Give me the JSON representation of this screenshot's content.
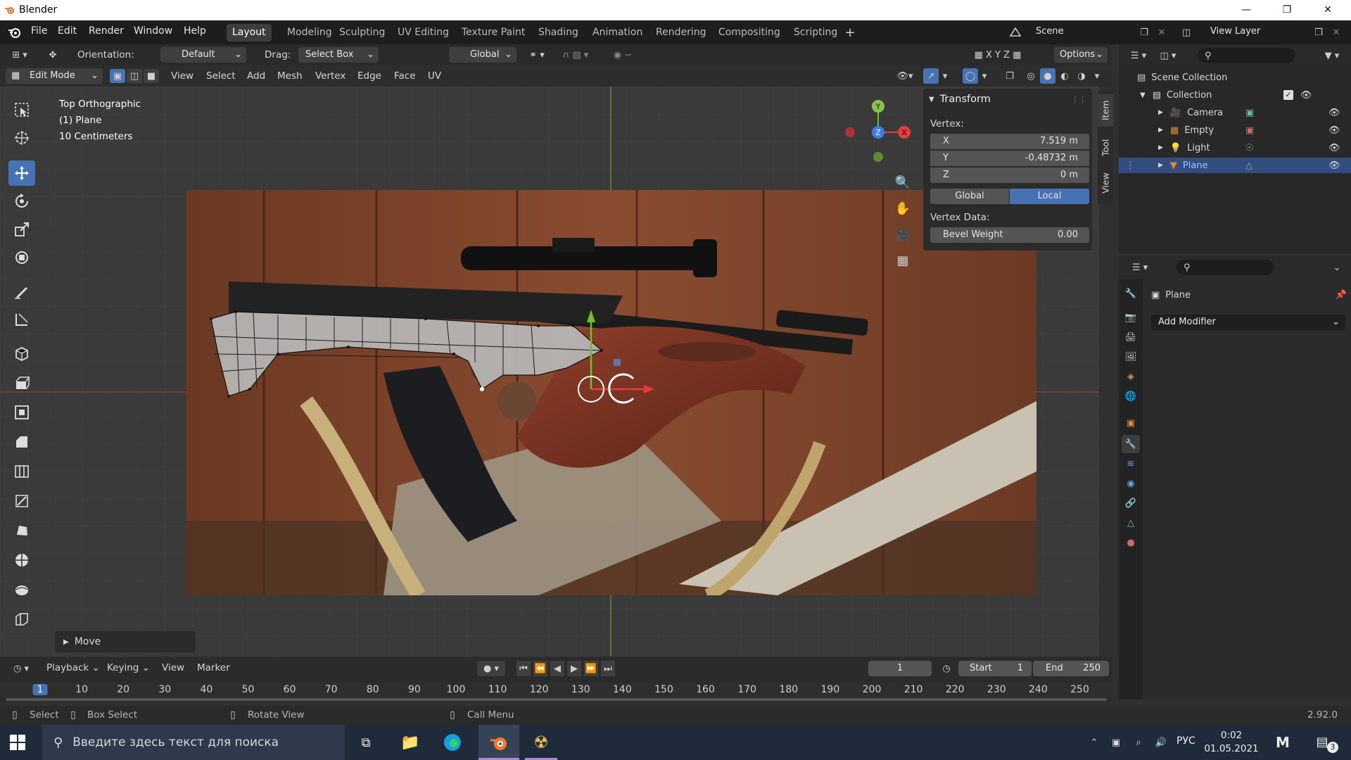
{
  "window": {
    "title": "Blender"
  },
  "menubar": {
    "items": [
      "File",
      "Edit",
      "Render",
      "Window",
      "Help"
    ]
  },
  "workspaces": {
    "tabs": [
      "Layout",
      "Modeling",
      "Sculpting",
      "UV Editing",
      "Texture Paint",
      "Shading",
      "Animation",
      "Rendering",
      "Compositing",
      "Scripting"
    ],
    "active": "Layout"
  },
  "scene": {
    "label": "Scene"
  },
  "view_layer": {
    "label": "View Layer"
  },
  "tool_header": {
    "orientation_label": "Orientation:",
    "orientation_value": "Default",
    "drag_label": "Drag:",
    "drag_value": "Select Box",
    "transform_orientation": "Global",
    "options_label": "Options"
  },
  "mode_header": {
    "mode": "Edit Mode",
    "menus": [
      "View",
      "Select",
      "Add",
      "Mesh",
      "Vertex",
      "Edge",
      "Face",
      "UV"
    ]
  },
  "viewport": {
    "view_name": "Top Orthographic",
    "object_name": "(1) Plane",
    "scale_text": "10 Centimeters",
    "last_op": "Move",
    "gizmo_axes": {
      "x": "X",
      "y": "Y",
      "z": "Z"
    }
  },
  "sidebar_tabs": [
    "Item",
    "Tool",
    "View"
  ],
  "transform_panel": {
    "title": "Transform",
    "vertex_label": "Vertex:",
    "fields": [
      {
        "axis": "X",
        "value": "7.519 m"
      },
      {
        "axis": "Y",
        "value": "-0.48732 m"
      },
      {
        "axis": "Z",
        "value": "0 m"
      }
    ],
    "space_buttons": [
      "Global",
      "Local"
    ],
    "active_space": "Local",
    "vertex_data_label": "Vertex Data:",
    "bevel_label": "Bevel Weight",
    "bevel_value": "0.00"
  },
  "outliner": {
    "root": "Scene Collection",
    "collection": "Collection",
    "items": [
      {
        "name": "Camera",
        "icon": "camera-icon",
        "selected": false
      },
      {
        "name": "Empty",
        "icon": "empty-icon",
        "selected": false
      },
      {
        "name": "Light",
        "icon": "light-icon",
        "selected": false
      },
      {
        "name": "Plane",
        "icon": "mesh-icon",
        "selected": true
      }
    ]
  },
  "properties": {
    "object_name": "Plane",
    "add_modifier": "Add Modifier"
  },
  "timeline": {
    "menus": [
      "Playback",
      "Keying",
      "View",
      "Marker"
    ],
    "current_frame": "1",
    "start_label": "Start",
    "start_value": "1",
    "end_label": "End",
    "end_value": "250",
    "ruler": [
      "1",
      "10",
      "20",
      "30",
      "40",
      "50",
      "60",
      "70",
      "80",
      "90",
      "100",
      "110",
      "120",
      "130",
      "140",
      "150",
      "160",
      "170",
      "180",
      "190",
      "200",
      "210",
      "220",
      "230",
      "240",
      "250"
    ]
  },
  "statusbar": {
    "select": "Select",
    "box_select": "Box Select",
    "rotate_view": "Rotate View",
    "call_menu": "Call Menu",
    "version": "2.92.0"
  },
  "taskbar": {
    "search_placeholder": "Введите здесь текст для поиска",
    "language": "РУС",
    "time": "0:02",
    "date": "01.05.2021",
    "notifications": "3"
  },
  "colors": {
    "accent": "#4772b3",
    "x_axis": "#e83b3b",
    "y_axis": "#8bc34a",
    "z_axis": "#3a7df0",
    "selection": "#334d80"
  }
}
